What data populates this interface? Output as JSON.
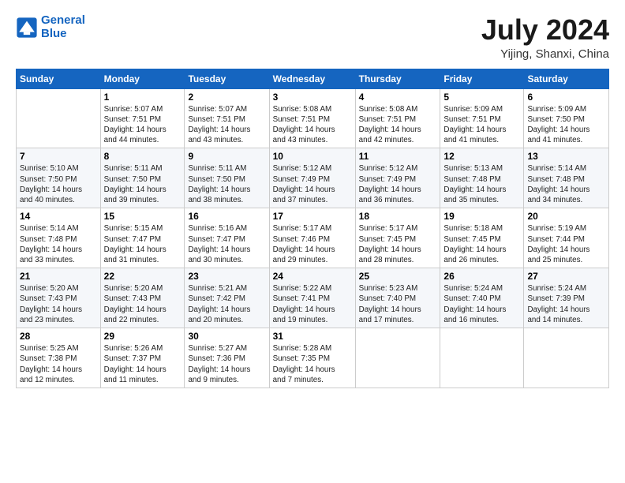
{
  "logo": {
    "line1": "General",
    "line2": "Blue"
  },
  "title": "July 2024",
  "location": "Yijing, Shanxi, China",
  "weekdays": [
    "Sunday",
    "Monday",
    "Tuesday",
    "Wednesday",
    "Thursday",
    "Friday",
    "Saturday"
  ],
  "weeks": [
    [
      {
        "day": "",
        "content": ""
      },
      {
        "day": "1",
        "content": "Sunrise: 5:07 AM\nSunset: 7:51 PM\nDaylight: 14 hours\nand 44 minutes."
      },
      {
        "day": "2",
        "content": "Sunrise: 5:07 AM\nSunset: 7:51 PM\nDaylight: 14 hours\nand 43 minutes."
      },
      {
        "day": "3",
        "content": "Sunrise: 5:08 AM\nSunset: 7:51 PM\nDaylight: 14 hours\nand 43 minutes."
      },
      {
        "day": "4",
        "content": "Sunrise: 5:08 AM\nSunset: 7:51 PM\nDaylight: 14 hours\nand 42 minutes."
      },
      {
        "day": "5",
        "content": "Sunrise: 5:09 AM\nSunset: 7:51 PM\nDaylight: 14 hours\nand 41 minutes."
      },
      {
        "day": "6",
        "content": "Sunrise: 5:09 AM\nSunset: 7:50 PM\nDaylight: 14 hours\nand 41 minutes."
      }
    ],
    [
      {
        "day": "7",
        "content": "Sunrise: 5:10 AM\nSunset: 7:50 PM\nDaylight: 14 hours\nand 40 minutes."
      },
      {
        "day": "8",
        "content": "Sunrise: 5:11 AM\nSunset: 7:50 PM\nDaylight: 14 hours\nand 39 minutes."
      },
      {
        "day": "9",
        "content": "Sunrise: 5:11 AM\nSunset: 7:50 PM\nDaylight: 14 hours\nand 38 minutes."
      },
      {
        "day": "10",
        "content": "Sunrise: 5:12 AM\nSunset: 7:49 PM\nDaylight: 14 hours\nand 37 minutes."
      },
      {
        "day": "11",
        "content": "Sunrise: 5:12 AM\nSunset: 7:49 PM\nDaylight: 14 hours\nand 36 minutes."
      },
      {
        "day": "12",
        "content": "Sunrise: 5:13 AM\nSunset: 7:48 PM\nDaylight: 14 hours\nand 35 minutes."
      },
      {
        "day": "13",
        "content": "Sunrise: 5:14 AM\nSunset: 7:48 PM\nDaylight: 14 hours\nand 34 minutes."
      }
    ],
    [
      {
        "day": "14",
        "content": "Sunrise: 5:14 AM\nSunset: 7:48 PM\nDaylight: 14 hours\nand 33 minutes."
      },
      {
        "day": "15",
        "content": "Sunrise: 5:15 AM\nSunset: 7:47 PM\nDaylight: 14 hours\nand 31 minutes."
      },
      {
        "day": "16",
        "content": "Sunrise: 5:16 AM\nSunset: 7:47 PM\nDaylight: 14 hours\nand 30 minutes."
      },
      {
        "day": "17",
        "content": "Sunrise: 5:17 AM\nSunset: 7:46 PM\nDaylight: 14 hours\nand 29 minutes."
      },
      {
        "day": "18",
        "content": "Sunrise: 5:17 AM\nSunset: 7:45 PM\nDaylight: 14 hours\nand 28 minutes."
      },
      {
        "day": "19",
        "content": "Sunrise: 5:18 AM\nSunset: 7:45 PM\nDaylight: 14 hours\nand 26 minutes."
      },
      {
        "day": "20",
        "content": "Sunrise: 5:19 AM\nSunset: 7:44 PM\nDaylight: 14 hours\nand 25 minutes."
      }
    ],
    [
      {
        "day": "21",
        "content": "Sunrise: 5:20 AM\nSunset: 7:43 PM\nDaylight: 14 hours\nand 23 minutes."
      },
      {
        "day": "22",
        "content": "Sunrise: 5:20 AM\nSunset: 7:43 PM\nDaylight: 14 hours\nand 22 minutes."
      },
      {
        "day": "23",
        "content": "Sunrise: 5:21 AM\nSunset: 7:42 PM\nDaylight: 14 hours\nand 20 minutes."
      },
      {
        "day": "24",
        "content": "Sunrise: 5:22 AM\nSunset: 7:41 PM\nDaylight: 14 hours\nand 19 minutes."
      },
      {
        "day": "25",
        "content": "Sunrise: 5:23 AM\nSunset: 7:40 PM\nDaylight: 14 hours\nand 17 minutes."
      },
      {
        "day": "26",
        "content": "Sunrise: 5:24 AM\nSunset: 7:40 PM\nDaylight: 14 hours\nand 16 minutes."
      },
      {
        "day": "27",
        "content": "Sunrise: 5:24 AM\nSunset: 7:39 PM\nDaylight: 14 hours\nand 14 minutes."
      }
    ],
    [
      {
        "day": "28",
        "content": "Sunrise: 5:25 AM\nSunset: 7:38 PM\nDaylight: 14 hours\nand 12 minutes."
      },
      {
        "day": "29",
        "content": "Sunrise: 5:26 AM\nSunset: 7:37 PM\nDaylight: 14 hours\nand 11 minutes."
      },
      {
        "day": "30",
        "content": "Sunrise: 5:27 AM\nSunset: 7:36 PM\nDaylight: 14 hours\nand 9 minutes."
      },
      {
        "day": "31",
        "content": "Sunrise: 5:28 AM\nSunset: 7:35 PM\nDaylight: 14 hours\nand 7 minutes."
      },
      {
        "day": "",
        "content": ""
      },
      {
        "day": "",
        "content": ""
      },
      {
        "day": "",
        "content": ""
      }
    ]
  ]
}
